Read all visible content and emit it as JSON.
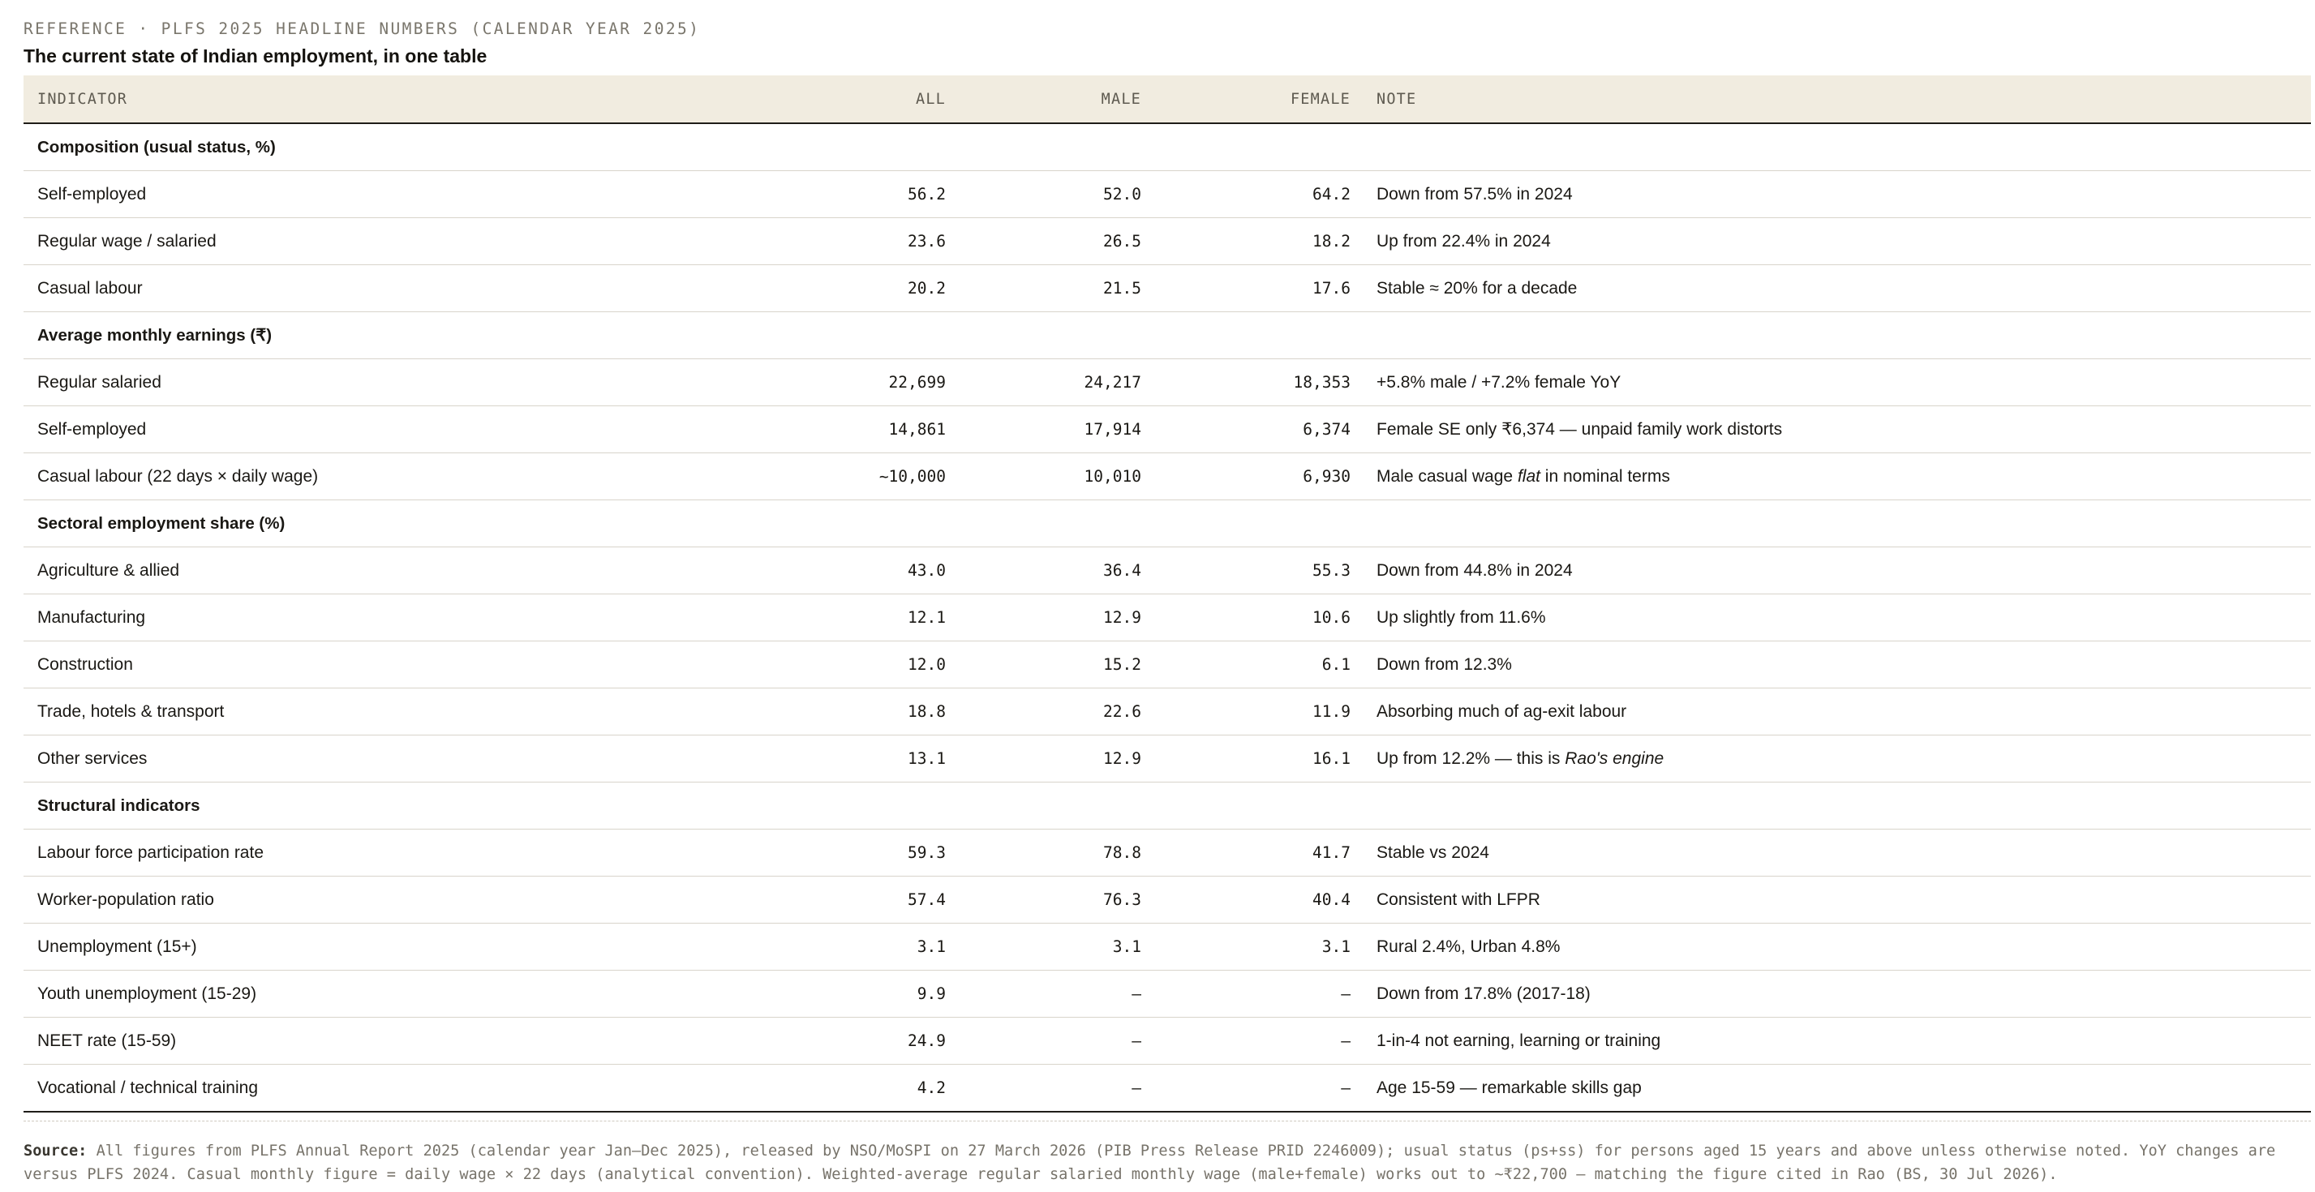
{
  "header": {
    "eyebrow": "REFERENCE · PLFS 2025 HEADLINE NUMBERS (CALENDAR YEAR 2025)",
    "title": "The current state of Indian employment, in one table"
  },
  "table": {
    "columns": {
      "indicator": "INDICATOR",
      "all": "ALL",
      "male": "MALE",
      "female": "FEMALE",
      "note": "NOTE"
    },
    "rows": [
      {
        "type": "section",
        "label": "Composition (usual status, %)"
      },
      {
        "type": "data",
        "label": "Self-employed",
        "all": "56.2",
        "male": "52.0",
        "female": "64.2",
        "note": "Down from 57.5% in 2024"
      },
      {
        "type": "data",
        "label": "Regular wage / salaried",
        "all": "23.6",
        "male": "26.5",
        "female": "18.2",
        "note": "Up from 22.4% in 2024"
      },
      {
        "type": "data",
        "label": "Casual labour",
        "all": "20.2",
        "male": "21.5",
        "female": "17.6",
        "note": "Stable ≈ 20% for a decade"
      },
      {
        "type": "section",
        "label": "Average monthly earnings (₹)"
      },
      {
        "type": "data",
        "label": "Regular salaried",
        "all": "22,699",
        "male": "24,217",
        "female": "18,353",
        "note": "+5.8% male / +7.2% female YoY"
      },
      {
        "type": "data",
        "label": "Self-employed",
        "all": "14,861",
        "male": "17,914",
        "female": "6,374",
        "note": "Female SE only ₹6,374 — unpaid family work distorts"
      },
      {
        "type": "data",
        "label": "Casual labour (22 days × daily wage)",
        "all": "~10,000",
        "male": "10,010",
        "female": "6,930",
        "note_pre": "Male casual wage ",
        "note_em": "flat",
        "note_post": " in nominal terms"
      },
      {
        "type": "section",
        "label": "Sectoral employment share (%)"
      },
      {
        "type": "data",
        "label": "Agriculture & allied",
        "all": "43.0",
        "male": "36.4",
        "female": "55.3",
        "note": "Down from 44.8% in 2024"
      },
      {
        "type": "data",
        "label": "Manufacturing",
        "all": "12.1",
        "male": "12.9",
        "female": "10.6",
        "note": "Up slightly from 11.6%"
      },
      {
        "type": "data",
        "label": "Construction",
        "all": "12.0",
        "male": "15.2",
        "female": "6.1",
        "note": "Down from 12.3%"
      },
      {
        "type": "data",
        "label": "Trade, hotels & transport",
        "all": "18.8",
        "male": "22.6",
        "female": "11.9",
        "note": "Absorbing much of ag-exit labour"
      },
      {
        "type": "data",
        "label": "Other services",
        "all": "13.1",
        "male": "12.9",
        "female": "16.1",
        "note_pre": "Up from 12.2% — this is ",
        "note_em": "Rao's engine",
        "note_post": ""
      },
      {
        "type": "section",
        "label": "Structural indicators"
      },
      {
        "type": "data",
        "label": "Labour force participation rate",
        "all": "59.3",
        "male": "78.8",
        "female": "41.7",
        "note": "Stable vs 2024"
      },
      {
        "type": "data",
        "label": "Worker-population ratio",
        "all": "57.4",
        "male": "76.3",
        "female": "40.4",
        "note": "Consistent with LFPR"
      },
      {
        "type": "data",
        "label": "Unemployment (15+)",
        "all": "3.1",
        "male": "3.1",
        "female": "3.1",
        "note": "Rural 2.4%, Urban 4.8%"
      },
      {
        "type": "data",
        "label": "Youth unemployment (15-29)",
        "all": "9.9",
        "male": "—",
        "female": "—",
        "note": "Down from 17.8% (2017-18)"
      },
      {
        "type": "data",
        "label": "NEET rate (15-59)",
        "all": "24.9",
        "male": "—",
        "female": "—",
        "note": "1-in-4 not earning, learning or training"
      },
      {
        "type": "data",
        "label": "Vocational / technical training",
        "all": "4.2",
        "male": "—",
        "female": "—",
        "note": "Age 15-59 — remarkable skills gap"
      }
    ]
  },
  "footer": {
    "source_label": "Source:",
    "source_text": "All figures from PLFS Annual Report 2025 (calendar year Jan–Dec 2025), released by NSO/MoSPI on 27 March 2026 (PIB Press Release PRID 2246009); usual status (ps+ss) for persons aged 15 years and above unless otherwise noted. YoY changes are versus PLFS 2024. Casual monthly figure = daily wage × 22 days (analytical convention). Weighted-average regular salaried monthly wage (male+female) works out to ~₹22,700 — matching the figure cited in Rao (BS, 30 Jul 2026)."
  }
}
